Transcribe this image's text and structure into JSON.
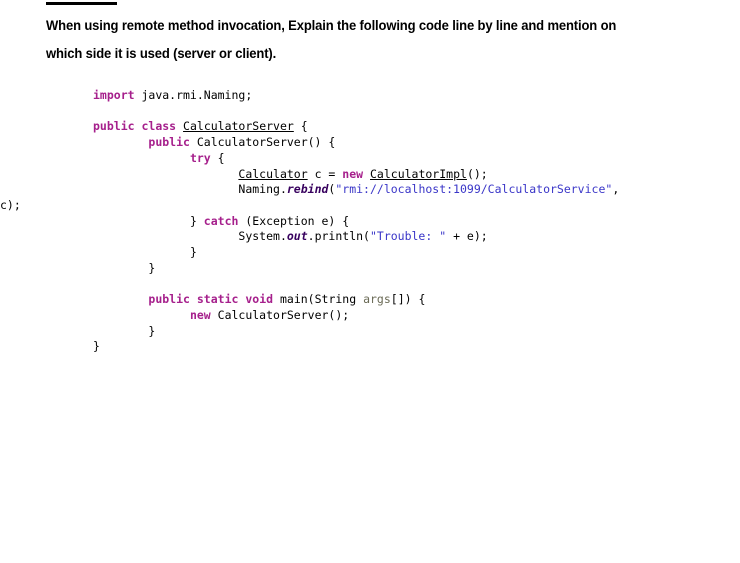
{
  "document": {
    "cut_heading_text": "",
    "question": "When using remote method invocation, Explain the following code line by line and mention on which side it is used (server or client).",
    "colors": {
      "keyword": "#a6208c",
      "string": "#3a36c8",
      "identifier_underlined": "#000000",
      "italic_member": "#37005e",
      "parameter": "#6a6a55",
      "text": "#000000",
      "page_background": "#ffffff"
    },
    "code": {
      "language": "java",
      "lines": [
        {
          "indent": 0,
          "tokens": [
            {
              "t": "import",
              "c": "kw"
            },
            {
              "t": " java.rmi.Naming;",
              "c": "plain"
            }
          ]
        },
        {
          "indent": 0,
          "tokens": []
        },
        {
          "indent": 0,
          "tokens": [
            {
              "t": "public",
              "c": "kw"
            },
            {
              "t": " ",
              "c": "plain"
            },
            {
              "t": "class",
              "c": "kw"
            },
            {
              "t": " ",
              "c": "plain"
            },
            {
              "t": "CalculatorServer",
              "c": "type-u"
            },
            {
              "t": " {",
              "c": "plain"
            }
          ]
        },
        {
          "indent": 8,
          "tokens": [
            {
              "t": "public",
              "c": "kw"
            },
            {
              "t": " CalculatorServer() {",
              "c": "plain"
            }
          ]
        },
        {
          "indent": 14,
          "tokens": [
            {
              "t": "try",
              "c": "kw"
            },
            {
              "t": " {",
              "c": "plain"
            }
          ]
        },
        {
          "indent": 21,
          "tokens": [
            {
              "t": "Calculator",
              "c": "type-u"
            },
            {
              "t": " c = ",
              "c": "plain"
            },
            {
              "t": "new",
              "c": "kw"
            },
            {
              "t": " ",
              "c": "plain"
            },
            {
              "t": "CalculatorImpl",
              "c": "type-u"
            },
            {
              "t": "();",
              "c": "plain"
            }
          ]
        },
        {
          "indent": 21,
          "tokens": [
            {
              "t": "Naming.",
              "c": "plain"
            },
            {
              "t": "rebind",
              "c": "ital"
            },
            {
              "t": "(",
              "c": "plain"
            },
            {
              "t": "\"rmi://localhost:1099/CalculatorService\"",
              "c": "str"
            },
            {
              "t": ",",
              "c": "plain"
            }
          ],
          "wrapped": {
            "indent": 0,
            "tokens": [
              {
                "t": "c);",
                "c": "plain"
              }
            ]
          }
        },
        {
          "indent": 14,
          "tokens": [
            {
              "t": "} ",
              "c": "plain"
            },
            {
              "t": "catch",
              "c": "kw"
            },
            {
              "t": " (Exception e) {",
              "c": "plain"
            }
          ]
        },
        {
          "indent": 21,
          "tokens": [
            {
              "t": "System.",
              "c": "plain"
            },
            {
              "t": "out",
              "c": "ital"
            },
            {
              "t": ".println(",
              "c": "plain"
            },
            {
              "t": "\"Trouble: \"",
              "c": "str"
            },
            {
              "t": " + e);",
              "c": "plain"
            }
          ]
        },
        {
          "indent": 14,
          "tokens": [
            {
              "t": "}",
              "c": "plain"
            }
          ]
        },
        {
          "indent": 8,
          "tokens": [
            {
              "t": "}",
              "c": "plain"
            }
          ]
        },
        {
          "indent": 0,
          "tokens": []
        },
        {
          "indent": 8,
          "tokens": [
            {
              "t": "public",
              "c": "kw"
            },
            {
              "t": " ",
              "c": "plain"
            },
            {
              "t": "static",
              "c": "kw"
            },
            {
              "t": " ",
              "c": "plain"
            },
            {
              "t": "void",
              "c": "kw"
            },
            {
              "t": " main(String ",
              "c": "plain"
            },
            {
              "t": "args",
              "c": "param"
            },
            {
              "t": "[]) {",
              "c": "plain"
            }
          ]
        },
        {
          "indent": 14,
          "tokens": [
            {
              "t": "new",
              "c": "kw"
            },
            {
              "t": " CalculatorServer();",
              "c": "plain"
            }
          ]
        },
        {
          "indent": 8,
          "tokens": [
            {
              "t": "}",
              "c": "plain"
            }
          ]
        },
        {
          "indent": 0,
          "tokens": [
            {
              "t": "}",
              "c": "plain"
            }
          ]
        }
      ]
    }
  }
}
